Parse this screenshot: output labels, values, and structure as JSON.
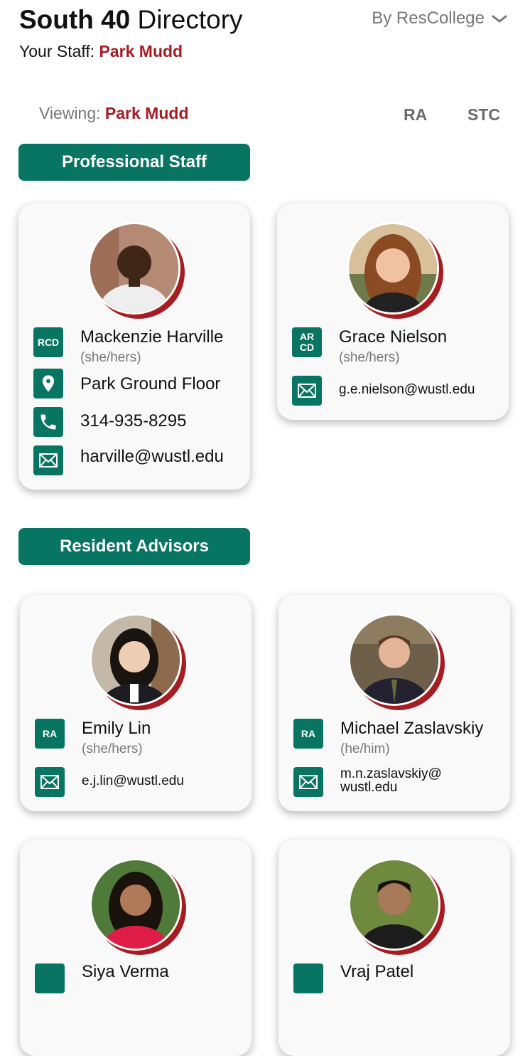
{
  "header": {
    "title_bold": "South 40",
    "title_rest": " Directory",
    "staff_label": "Your Staff: ",
    "staff_value": "Park Mudd",
    "group_by": "By ResCollege"
  },
  "viewing": {
    "label": "Viewing: ",
    "value": "Park Mudd"
  },
  "tabs": [
    "RA",
    "STC"
  ],
  "sections": {
    "professional": "Professional Staff",
    "residents": "Resident Advisors"
  },
  "professional_staff": [
    {
      "role": "RCD",
      "name": "Mackenzie Harville",
      "pronouns": "(she/hers)",
      "location": "Park Ground Floor",
      "phone": "314-935-8295",
      "email": "harville@wustl.edu"
    },
    {
      "role_line1": "AR",
      "role_line2": "CD",
      "name": "Grace Nielson",
      "pronouns": "(she/hers)",
      "email": "g.e.nielson@wustl.edu"
    }
  ],
  "resident_advisors": [
    {
      "role": "RA",
      "name": "Emily Lin",
      "pronouns": "(she/hers)",
      "email": "e.j.lin@wustl.edu"
    },
    {
      "role": "RA",
      "name": "Michael Zaslavskiy",
      "pronouns": "(he/him)",
      "email_line1": "m.n.zaslavskiy@",
      "email_line2": "wustl.edu"
    },
    {
      "name": "Siya Verma"
    },
    {
      "name": "Vraj Patel"
    }
  ],
  "icons": [
    "chevron-down-icon",
    "location-pin-icon",
    "phone-icon",
    "mail-icon"
  ],
  "colors": {
    "accent_green": "#077561",
    "accent_red": "#a51c22",
    "muted": "#777777"
  }
}
